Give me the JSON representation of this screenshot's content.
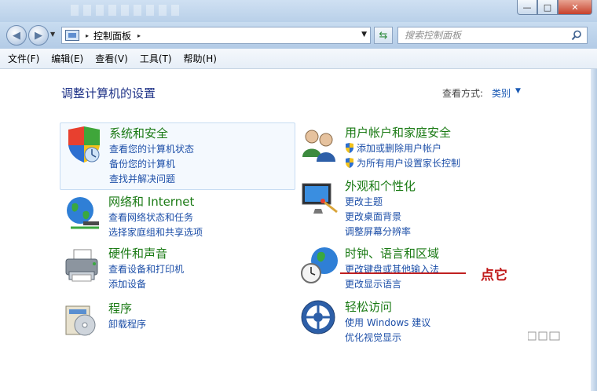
{
  "window": {
    "minimize_label": "—",
    "maximize_label": "□",
    "close_label": "✕"
  },
  "navigation": {
    "back_icon": "back-arrow-icon",
    "forward_icon": "forward-arrow-icon",
    "address_path": "控制面板",
    "address_separator": "▸",
    "refresh_icon": "refresh-icon",
    "search_placeholder": "搜索控制面板"
  },
  "menu": {
    "items": [
      "文件(F)",
      "编辑(E)",
      "查看(V)",
      "工具(T)",
      "帮助(H)"
    ]
  },
  "main": {
    "title": "调整计算机的设置",
    "view_by_label": "查看方式:",
    "view_by_value": "类别"
  },
  "categories": [
    {
      "title": "系统和安全",
      "icon": "shield-computer-icon",
      "links": [
        "查看您的计算机状态",
        "备份您的计算机",
        "查找并解决问题"
      ]
    },
    {
      "title": "网络和 Internet",
      "icon": "network-globe-icon",
      "links": [
        "查看网络状态和任务",
        "选择家庭组和共享选项"
      ]
    },
    {
      "title": "硬件和声音",
      "icon": "printer-icon",
      "links": [
        "查看设备和打印机",
        "添加设备"
      ]
    },
    {
      "title": "程序",
      "icon": "programs-disc-icon",
      "links": [
        "卸载程序"
      ]
    },
    {
      "title": "用户帐户和家庭安全",
      "icon": "users-icon",
      "links": [
        "添加或删除用户帐户",
        "为所有用户设置家长控制"
      ]
    },
    {
      "title": "外观和个性化",
      "icon": "appearance-monitor-icon",
      "links": [
        "更改主题",
        "更改桌面背景",
        "调整屏幕分辨率"
      ]
    },
    {
      "title": "时钟、语言和区域",
      "icon": "clock-globe-icon",
      "links": [
        "更改键盘或其他输入法",
        "更改显示语言"
      ]
    },
    {
      "title": "轻松访问",
      "icon": "ease-of-access-icon",
      "links": [
        "使用 Windows 建议",
        "优化视觉显示"
      ]
    }
  ],
  "annotation": {
    "text": "点它",
    "color": "#c01818"
  },
  "colors": {
    "category_title": "#1a7a14",
    "link": "#1d4fa8",
    "page_title": "#1e3287"
  }
}
